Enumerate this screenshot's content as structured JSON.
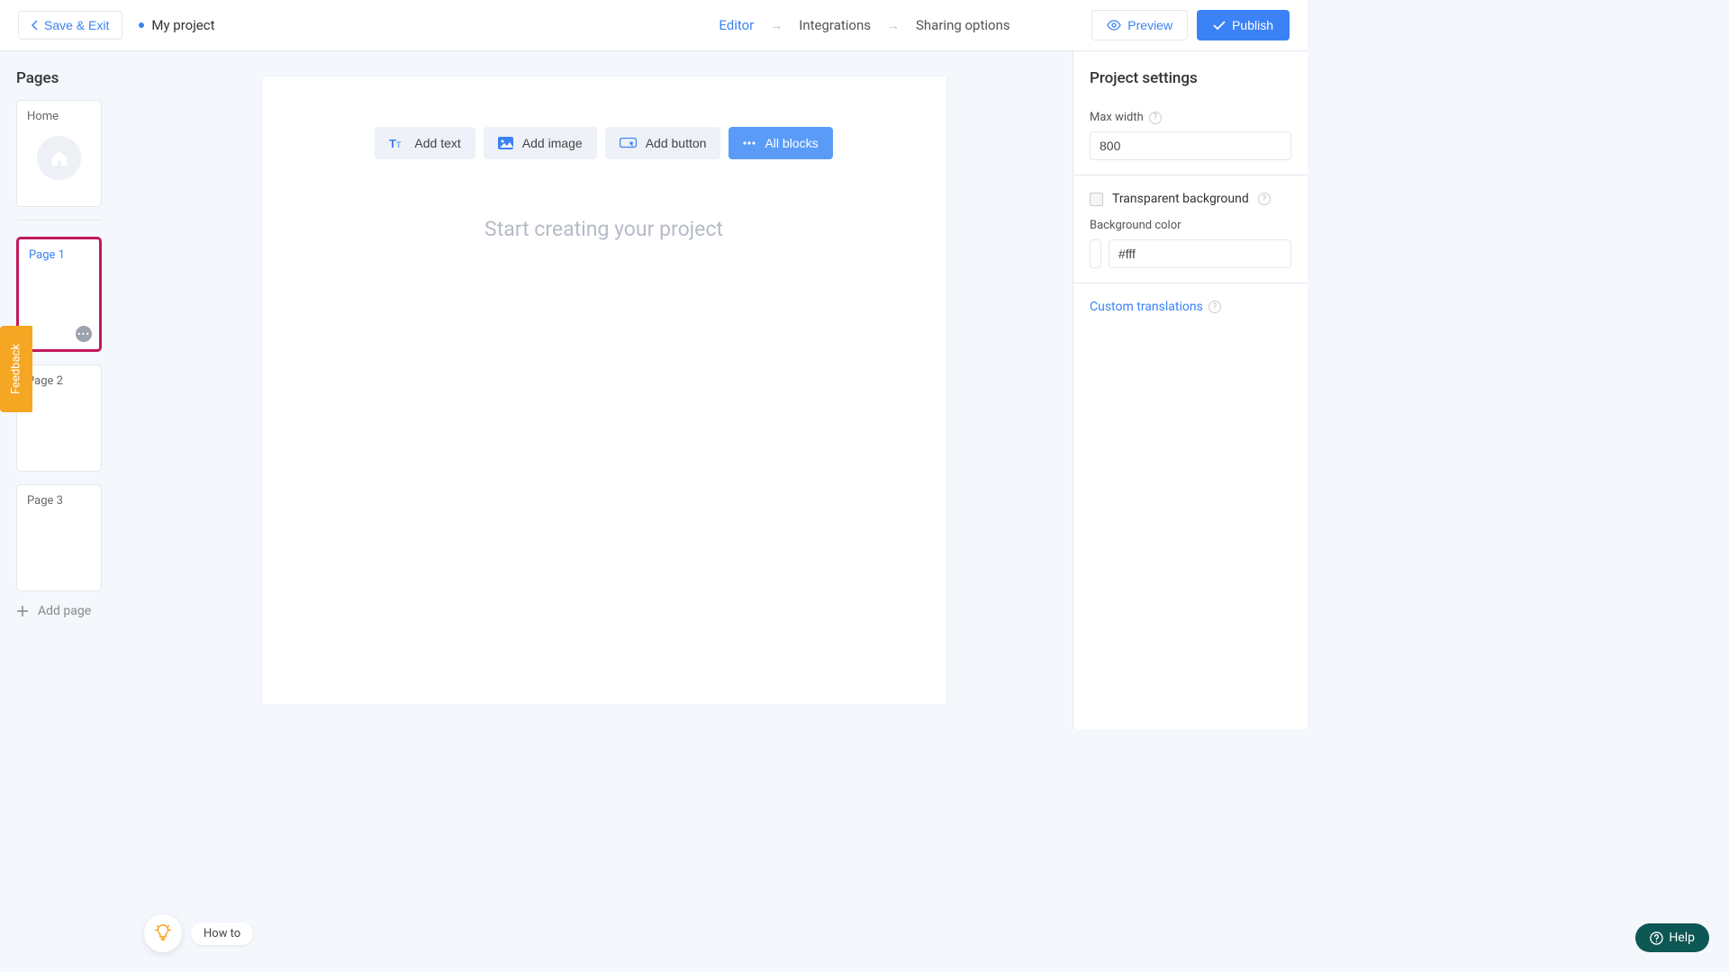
{
  "header": {
    "save_exit": "Save & Exit",
    "project_name": "My project",
    "nav": {
      "editor": "Editor",
      "integrations": "Integrations",
      "sharing": "Sharing options"
    },
    "preview": "Preview",
    "publish": "Publish"
  },
  "sidebar": {
    "title": "Pages",
    "pages": [
      {
        "label": "Home"
      },
      {
        "label": "Page 1"
      },
      {
        "label": "Page 2"
      },
      {
        "label": "Page 3"
      }
    ],
    "add_page": "Add page"
  },
  "toolbar": {
    "add_text": "Add text",
    "add_image": "Add image",
    "add_button": "Add button",
    "all_blocks": "All blocks"
  },
  "canvas": {
    "placeholder": "Start creating your project"
  },
  "settings": {
    "title": "Project settings",
    "max_width_label": "Max width",
    "max_width_value": "800",
    "transparent_bg_label": "Transparent background",
    "bg_color_label": "Background color",
    "bg_color_value": "#fff",
    "custom_translations": "Custom translations"
  },
  "feedback": "Feedback",
  "howto": "How to",
  "help": "Help"
}
